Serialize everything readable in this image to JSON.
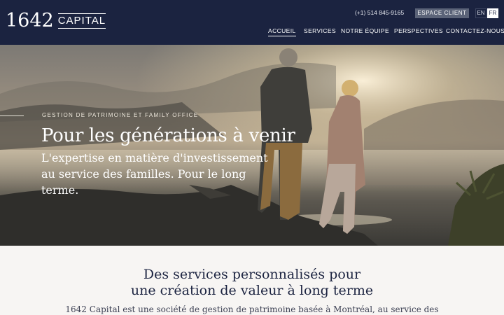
{
  "header": {
    "logo_number": "1642",
    "logo_word": "CAPITAL",
    "phone": "(+1) 514 845-9165",
    "client_button": "ESPACE CLIENT",
    "lang_en": "EN",
    "lang_fr": "FR",
    "nav": {
      "home": "ACCUEIL",
      "services": "SERVICES",
      "team": "NOTRE ÉQUIPE",
      "perspectives": "PERSPECTIVES",
      "contact": "CONTACTEZ-NOUS"
    }
  },
  "hero": {
    "eyebrow": "GESTION DE PATRIMOINE ET FAMILY OFFICE",
    "title": "Pour les générations à venir",
    "subtitle": "L'expertise en matière d'investissement au service des familles. Pour le long terme."
  },
  "services": {
    "title_line1": "Des services personnalisés pour",
    "title_line2": "une création de valeur à long terme",
    "body": "1642 Capital est une société de gestion de patrimoine basée à Montréal, au service des"
  }
}
